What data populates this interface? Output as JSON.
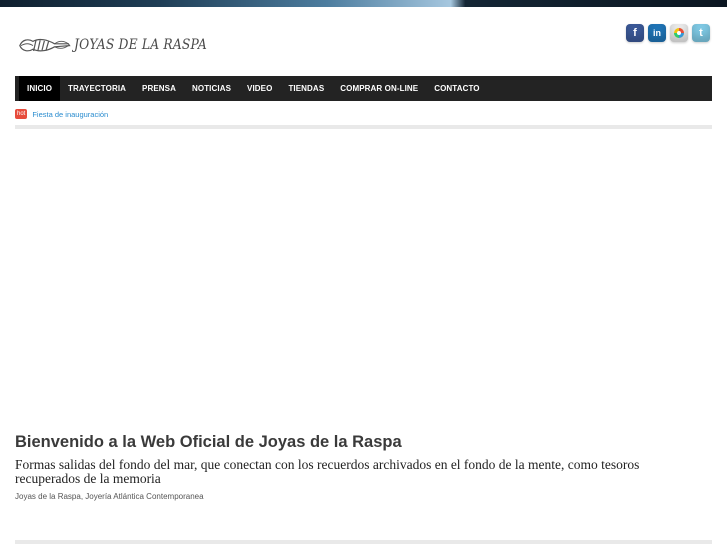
{
  "site": {
    "logo_text": "JOYAS DE LA RASPA"
  },
  "social": [
    {
      "name": "facebook",
      "icon": "facebook-icon",
      "glyph": "f"
    },
    {
      "name": "linkedin",
      "icon": "linkedin-icon",
      "glyph": "in"
    },
    {
      "name": "picasa",
      "icon": "picasa-icon",
      "glyph": ""
    },
    {
      "name": "twitter",
      "icon": "twitter-icon",
      "glyph": "t"
    }
  ],
  "nav": {
    "items": [
      {
        "label": "INICIO",
        "active": true
      },
      {
        "label": "TRAYECTORIA",
        "active": false
      },
      {
        "label": "PRENSA",
        "active": false
      },
      {
        "label": "NOTICIAS",
        "active": false
      },
      {
        "label": "VIDEO",
        "active": false
      },
      {
        "label": "TIENDAS",
        "active": false
      },
      {
        "label": "COMPRAR ON-LINE",
        "active": false
      },
      {
        "label": "CONTACTO",
        "active": false
      }
    ]
  },
  "ticker": {
    "badge": "hot",
    "link": "Fiesta de inauguración"
  },
  "welcome": {
    "title": "Bienvenido a la Web Oficial de Joyas de la Raspa",
    "subtitle": "Formas salidas del fondo del mar, que conectan con los recuerdos archivados en el fondo de la mente, como tesoros recuperados de la memoria",
    "small": "Joyas de la Raspa, Joyería Atlántica Contemporanea"
  },
  "colors": {
    "nav_background": "#232323",
    "nav_active": "#000000",
    "ticker_link": "#2a8ccf",
    "hot_badge": "#e74c3c"
  }
}
